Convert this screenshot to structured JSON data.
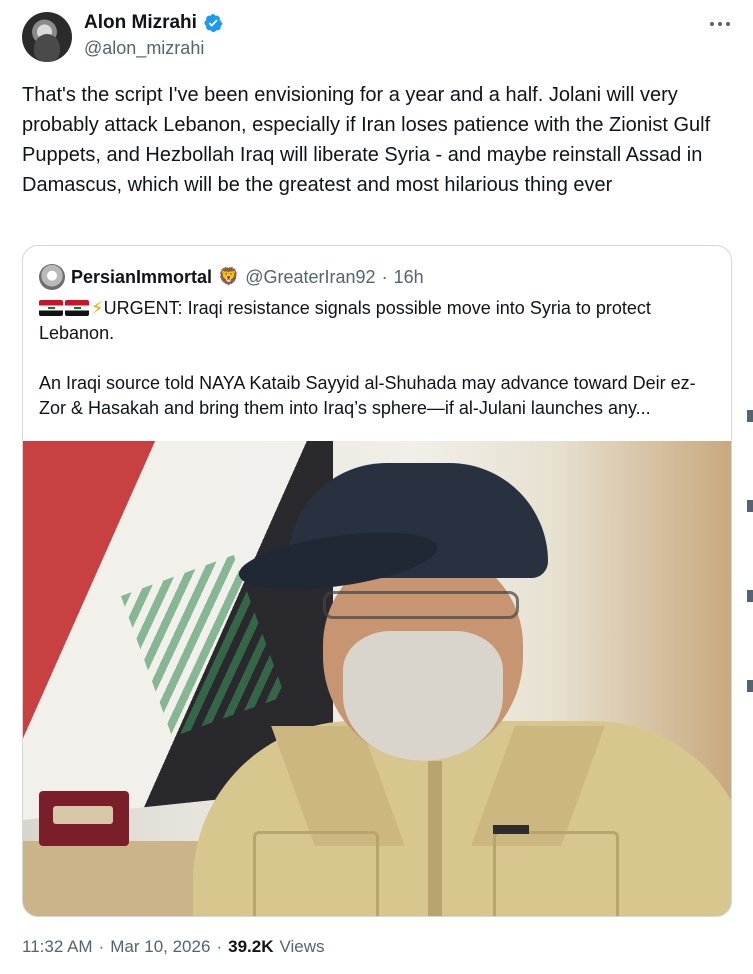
{
  "tweet": {
    "author_name": "Alon Mizrahi",
    "author_handle": "@alon_mizrahi",
    "text": "That's the script I've been envisioning for a year and a half. Jolani will very probably attack Lebanon, especially if Iran loses patience with the Zionist Gulf Puppets, and Hezbollah Iraq will liberate Syria - and maybe reinstall Assad in Damascus, which will be the greatest and most hilarious thing ever",
    "time": "11:32 AM",
    "date": "Mar 10, 2026",
    "views_count": "39.2K",
    "views_label": "Views",
    "separator": "·"
  },
  "quote": {
    "author_name": "PersianImmortal",
    "author_emoji": "🦁",
    "author_handle": "@GreaterIran92",
    "separator": "·",
    "time": "16h",
    "line1": "URGENT: Iraqi resistance signals possible move into Syria to protect Lebanon.",
    "line1_emoji": "⚡",
    "line2": "An Iraqi source told NAYA Kataib Sayyid al-Shuhada may advance toward Deir ez-Zor & Hasakah and bring them into Iraq’s sphere—if al-Julani launches any..."
  },
  "icons": {
    "verified": "verified-badge-icon",
    "more": "more-options-icon",
    "flags": "iraq-flag-icon"
  },
  "colors": {
    "text": "#0f1419",
    "secondary": "#536471",
    "verified": "#1d9bf0",
    "border": "#cfd9de"
  }
}
